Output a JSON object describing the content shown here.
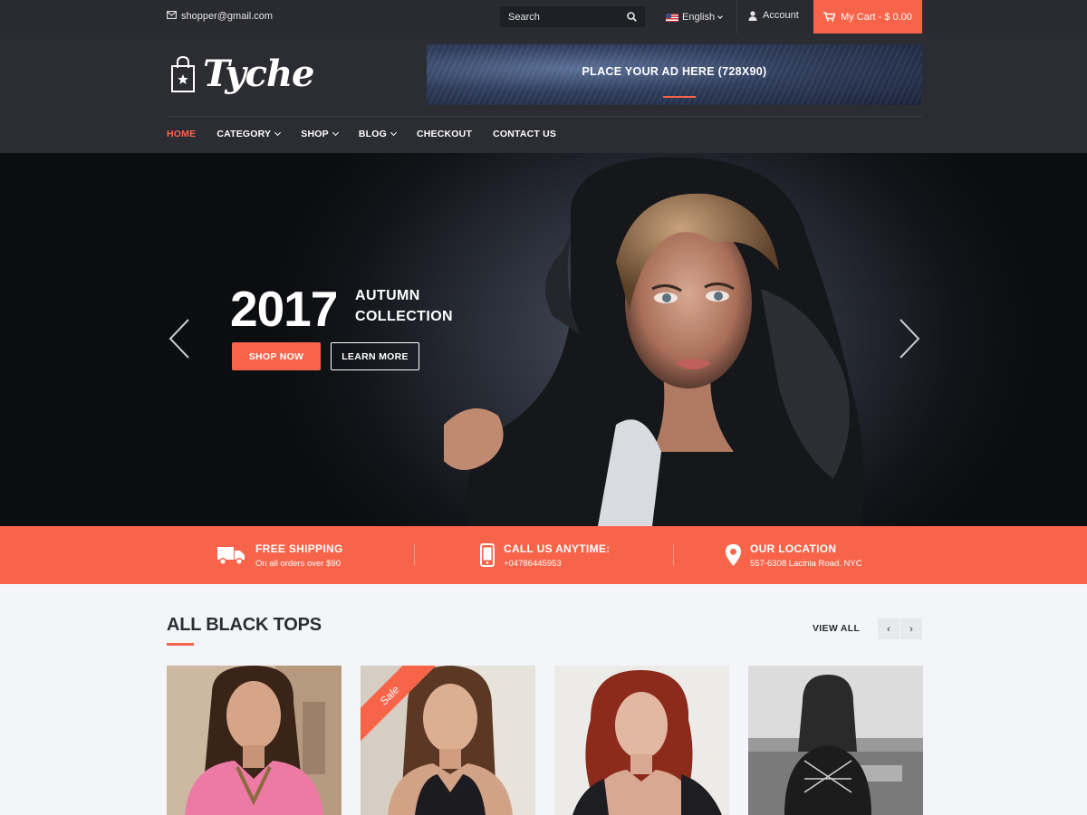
{
  "topbar": {
    "email": "shopper@gmail.com",
    "search_placeholder": "Search",
    "language": "English",
    "account": "Account",
    "cart": "My Cart - $ 0.00"
  },
  "header": {
    "logo": "Tyche",
    "ad_text": "PLACE YOUR AD HERE (728X90)"
  },
  "nav": {
    "items": [
      {
        "label": "HOME",
        "active": true
      },
      {
        "label": "CATEGORY",
        "dropdown": true
      },
      {
        "label": "SHOP",
        "dropdown": true
      },
      {
        "label": "BLOG",
        "dropdown": true
      },
      {
        "label": "CHECKOUT"
      },
      {
        "label": "CONTACT US"
      }
    ]
  },
  "hero": {
    "year": "2017",
    "collection_line1": "AUTUMN",
    "collection_line2": "COLLECTION",
    "shop_now": "SHOP NOW",
    "learn_more": "LEARN MORE"
  },
  "features": [
    {
      "title": "FREE SHIPPING",
      "subtitle": "On all orders over $90",
      "icon": "truck-icon"
    },
    {
      "title": "CALL US ANYTIME:",
      "subtitle": "+04786445953",
      "icon": "phone-icon"
    },
    {
      "title": "OUR LOCATION",
      "subtitle": "557-6308 Lacinia Road. NYC",
      "icon": "map-pin-icon"
    }
  ],
  "products": {
    "section_title": "ALL BLACK TOPS",
    "view_all": "VIEW ALL",
    "sale_label": "Sale"
  },
  "colors": {
    "accent": "#f8644a",
    "topbar_bg": "#2a2b31",
    "header_bg": "#2c2d33"
  }
}
